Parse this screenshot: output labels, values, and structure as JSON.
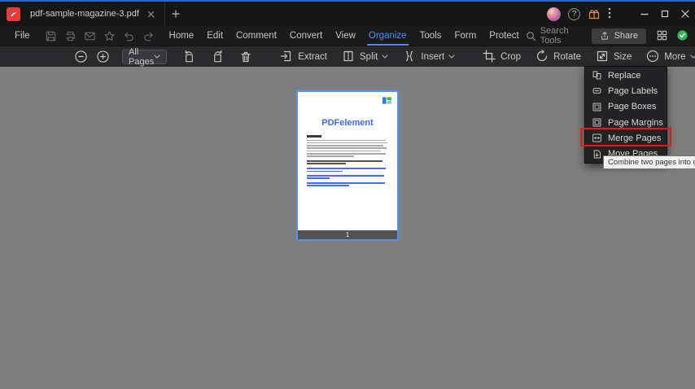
{
  "titlebar": {
    "tab_title": "pdf-sample-magazine-3.pdf",
    "help_glyph": "?"
  },
  "menubar": {
    "file_label": "File",
    "items": [
      {
        "label": "Home"
      },
      {
        "label": "Edit"
      },
      {
        "label": "Comment"
      },
      {
        "label": "Convert"
      },
      {
        "label": "View"
      },
      {
        "label": "Organize"
      },
      {
        "label": "Tools"
      },
      {
        "label": "Form"
      },
      {
        "label": "Protect"
      }
    ],
    "active_item": "Organize",
    "search_label": "Search Tools",
    "share_label": "Share"
  },
  "toolbar": {
    "page_range": {
      "value": "All Pages"
    },
    "extract_label": "Extract",
    "split_label": "Split",
    "insert_label": "Insert",
    "crop_label": "Crop",
    "rotate_label": "Rotate",
    "size_label": "Size",
    "more_label": "More"
  },
  "more_menu": {
    "items": [
      {
        "label": "Replace"
      },
      {
        "label": "Page Labels"
      },
      {
        "label": "Page Boxes"
      },
      {
        "label": "Page Margins"
      },
      {
        "label": "Merge Pages"
      },
      {
        "label": "Move Pages"
      }
    ],
    "highlighted_item": "Merge Pages"
  },
  "tooltip": {
    "text": "Combine two pages into one,"
  },
  "document": {
    "page_title": "PDFelement",
    "page_number": "1"
  },
  "colors": {
    "accent_blue": "#4a8cff",
    "annotation_red": "#e01b1b",
    "status_green": "#35b558",
    "canvas_gray": "#7e7e7e",
    "selection_blue": "#4f94f2"
  }
}
